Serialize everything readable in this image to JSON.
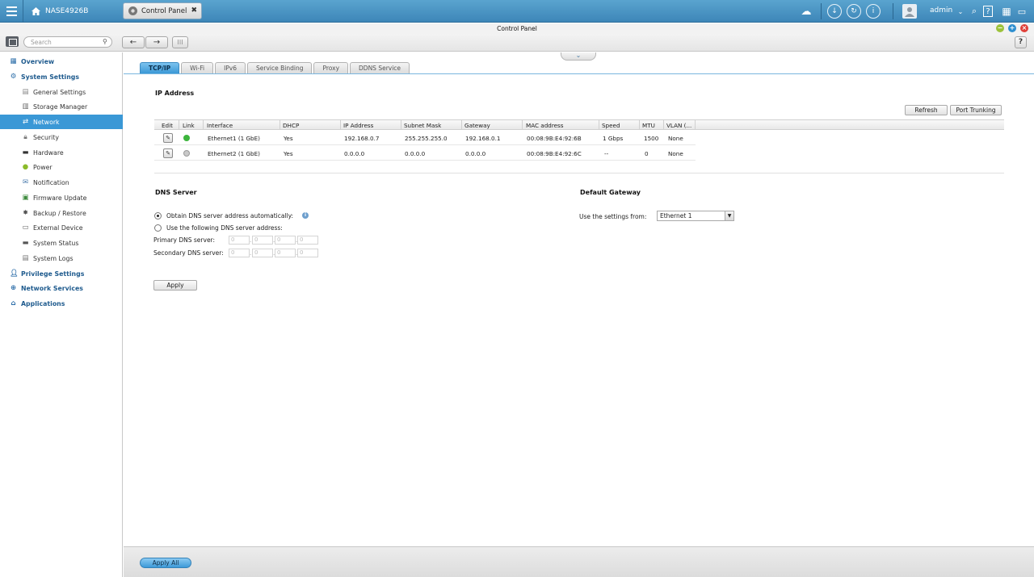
{
  "topbar": {
    "device_name": "NASE4926B",
    "app_tab": "Control Panel",
    "user": "admin"
  },
  "window": {
    "title": "Control Panel"
  },
  "toolbar": {
    "search_placeholder": "Search"
  },
  "sidebar": {
    "overview": "Overview",
    "system_settings": "System Settings",
    "sub_items": [
      "General Settings",
      "Storage Manager",
      "Network",
      "Security",
      "Hardware",
      "Power",
      "Notification",
      "Firmware Update",
      "Backup / Restore",
      "External Device",
      "System Status",
      "System Logs"
    ],
    "privilege_settings": "Privilege Settings",
    "network_services": "Network Services",
    "applications": "Applications"
  },
  "tabs": [
    "TCP/IP",
    "Wi-Fi",
    "IPv6",
    "Service Binding",
    "Proxy",
    "DDNS Service"
  ],
  "ip_section": {
    "title": "IP Address",
    "refresh": "Refresh",
    "port_trunking": "Port Trunking",
    "columns": [
      "Edit",
      "Link",
      "Interface",
      "DHCP",
      "IP Address",
      "Subnet Mask",
      "Gateway",
      "MAC address",
      "Speed",
      "MTU",
      "VLAN (..."
    ],
    "rows": [
      {
        "interface": "Ethernet1 (1 GbE)",
        "dhcp": "Yes",
        "ip": "192.168.0.7",
        "mask": "255.255.255.0",
        "gateway": "192.168.0.1",
        "mac": "00:08:9B:E4:92:6B",
        "speed": "1 Gbps",
        "mtu": "1500",
        "vlan": "None",
        "link_color": "#3cb53c"
      },
      {
        "interface": "Ethernet2 (1 GbE)",
        "dhcp": "Yes",
        "ip": "0.0.0.0",
        "mask": "0.0.0.0",
        "gateway": "0.0.0.0",
        "mac": "00:08:9B:E4:92:6C",
        "speed": "--",
        "mtu": "0",
        "vlan": "None",
        "link_color": "#c9c9c9"
      }
    ]
  },
  "dns": {
    "title": "DNS Server",
    "auto_label": "Obtain DNS server address automatically:",
    "manual_label": "Use the following DNS server address:",
    "primary_label": "Primary DNS server:",
    "secondary_label": "Secondary DNS server:",
    "octet_placeholder": "0",
    "selected": "auto"
  },
  "gateway": {
    "title": "Default Gateway",
    "use_label": "Use the settings from:",
    "selected": "Ethernet 1"
  },
  "apply": "Apply",
  "apply_all": "Apply All"
}
